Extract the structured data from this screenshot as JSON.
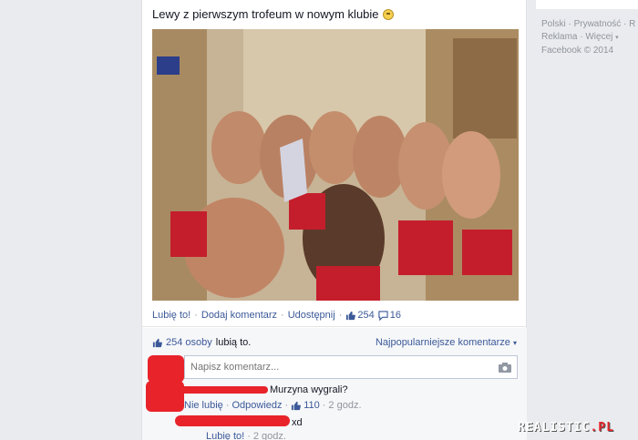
{
  "post": {
    "text": "Lewy z pierwszym trofeum w nowym klubie",
    "emoji": "smile-emoji"
  },
  "actions": {
    "like": "Lubię to!",
    "comment": "Dodaj komentarz",
    "share": "Udostępnij",
    "like_count": "254",
    "comment_count": "16"
  },
  "likes_bar": {
    "people": "254 osoby",
    "suffix": "lubią to.",
    "sort": "Najpopularniejsze komentarze"
  },
  "comment_input": {
    "placeholder": "Napisz komentarz..."
  },
  "comments": [
    {
      "text": "Murzyna wygrali?",
      "unlike": "Nie lubię",
      "reply": "Odpowiedz",
      "likes": "110",
      "time": "2 godz."
    },
    {
      "text": "xd",
      "like": "Lubię to!",
      "time": "2 godz."
    }
  ],
  "footer": {
    "line1_a": "Polski",
    "line1_b": "Prywatność",
    "line1_c": "R",
    "line2_a": "Reklama",
    "line2_b": "Więcej",
    "line3": "Facebook © 2014"
  },
  "watermark": {
    "main": "REALISTIC",
    "suffix": ".PL"
  },
  "colors": {
    "link": "#3b5998",
    "censor": "#e8232a",
    "background": "#e9ebee"
  }
}
